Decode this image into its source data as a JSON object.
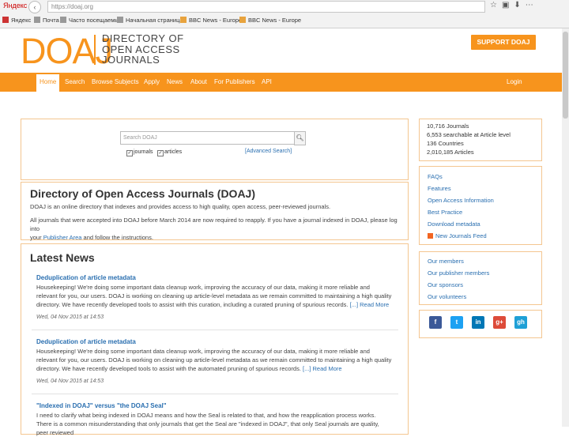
{
  "browser": {
    "brand": "Яндекс",
    "url": "https://doaj.org",
    "bookmarks": [
      "Яндекс",
      "Почта",
      "Часто посещаемые",
      "Начальная страница",
      "BBC News - Europe",
      "BBC News - Europe"
    ]
  },
  "header": {
    "logo": "DOAJ",
    "tagline_1": "DIRECTORY OF",
    "tagline_2": "OPEN ACCESS",
    "tagline_3": "JOURNALS",
    "support_button": "SUPPORT DOAJ",
    "accent_color": "#f7941d"
  },
  "nav": {
    "items": [
      "Home",
      "Search",
      "Browse Subjects",
      "Apply",
      "News",
      "About",
      "For Publishers",
      "API"
    ],
    "login": "Login"
  },
  "search": {
    "placeholder": "Search DOAJ",
    "opt_journals": "journals",
    "opt_articles": "articles",
    "advanced": "[Advanced Search]"
  },
  "intro": {
    "title": "Directory of Open Access Journals (DOAJ)",
    "para1": "DOAJ is an online directory that indexes and provides access to high quality, open access, peer-reviewed journals.",
    "para2_a": "All journals that were accepted into DOAJ before March 2014 are now required to reapply. If you have a journal indexed in DOAJ, please log into",
    "para2_b_pre": "your ",
    "para2_link": "Publisher Area",
    "para2_b_post": " and follow the instructions."
  },
  "news": {
    "heading": "Latest News",
    "items": [
      {
        "title": "Deduplication of article metadata",
        "body": "Housekeeping! We're doing some important data cleanup work, improving the accuracy of our data, making it more reliable and relevant for you, our users. DOAJ is working on cleaning up article-level metadata as we remain committed to maintaining a high quality directory. We have recently developed tools to assist with this curation, including a curated pruning of spurious records.",
        "more": "[...] Read More",
        "date": "Wed, 04 Nov 2015 at 14:53"
      },
      {
        "title": "Deduplication of article metadata",
        "body": "Housekeeping! We're doing some important data cleanup work, improving the accuracy of our data, making it more reliable and relevant for you, our users. DOAJ is working on cleaning up article-level metadata as we remain committed to maintaining a high quality directory. We have recently developed tools to assist with the automated pruning of spurious records.",
        "more": "[...] Read More",
        "date": "Wed, 04 Nov 2015 at 14:53"
      },
      {
        "title": "\"Indexed in DOAJ\" versus \"the DOAJ Seal\"",
        "body": "I need to clarify what being indexed in DOAJ means and how the Seal is related to that, and how the reapplication process works. There is a common misunderstanding that only journals that get the Seal are \"indexed in DOAJ\", that only Seal journals are quality, peer reviewed",
        "more": "",
        "date": ""
      }
    ]
  },
  "stats": {
    "journals": "10,716 Journals",
    "searchable": "6,553 searchable at Article level",
    "countries": "136 Countries",
    "articles": "2,010,185 Articles"
  },
  "info_links": [
    "FAQs",
    "Features",
    "Open Access Information",
    "Best Practice",
    "Download metadata",
    "New Journals Feed"
  ],
  "community_links": [
    "Our members",
    "Our publisher members",
    "Our sponsors",
    "Our volunteers"
  ],
  "social": [
    {
      "label": "f",
      "color": "#3b5998"
    },
    {
      "label": "t",
      "color": "#1da1f2"
    },
    {
      "label": "in",
      "color": "#0077b5"
    },
    {
      "label": "g+",
      "color": "#dd4b39"
    },
    {
      "label": "gh",
      "color": "#1fa0d6"
    }
  ]
}
